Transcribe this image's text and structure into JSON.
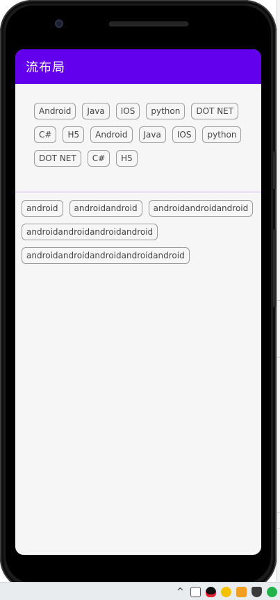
{
  "app": {
    "title": "流布局"
  },
  "flow_one": {
    "tags": [
      "Android",
      "Java",
      "IOS",
      "python",
      "DOT NET",
      "C#",
      "H5",
      "Android",
      "Java",
      "IOS",
      "python",
      "DOT NET",
      "C#",
      "H5"
    ]
  },
  "flow_two": {
    "tags": [
      "android",
      "androidandroid",
      "androidandroidandroid",
      "androidandroidandroidandroid",
      "androidandroidandroidandroidandroid"
    ]
  },
  "colors": {
    "app_bar": "#6200ee",
    "screen_background": "#f6f6f6",
    "tag_border": "#9a9a9a",
    "tag_text": "#444444",
    "divider": "#c9b2f5"
  },
  "tray": {
    "icons": [
      "chevron-up-icon",
      "device-icon",
      "penguin-icon",
      "add-icon",
      "calendar-icon",
      "shield-icon",
      "chat-icon"
    ]
  }
}
